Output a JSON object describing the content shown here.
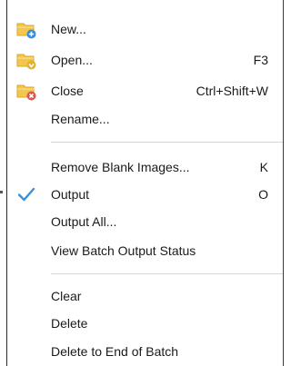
{
  "menu": {
    "items": [
      {
        "label": "New...",
        "shortcut": "",
        "icon": "folder-new-icon"
      },
      {
        "label": "Open...",
        "shortcut": "F3",
        "icon": "folder-open-icon"
      },
      {
        "label": "Close",
        "shortcut": "Ctrl+Shift+W",
        "icon": "folder-close-icon"
      },
      {
        "label": "Rename...",
        "shortcut": ""
      },
      {
        "label": "Remove Blank Images...",
        "shortcut": "K"
      },
      {
        "label": "Output",
        "shortcut": "O",
        "icon": "checkmark-icon",
        "checked": true
      },
      {
        "label": "Output All...",
        "shortcut": ""
      },
      {
        "label": "View Batch Output Status",
        "shortcut": ""
      },
      {
        "label": "Clear",
        "shortcut": ""
      },
      {
        "label": "Delete",
        "shortcut": ""
      },
      {
        "label": "Delete to End of Batch",
        "shortcut": ""
      }
    ]
  },
  "colors": {
    "folder": "#f3c74f",
    "folder_dark": "#d9a52b",
    "new_badge": "#2f8fd8",
    "open_badge": "#e3b22a",
    "close_badge": "#e0544f",
    "check": "#3d8fd6",
    "separator": "#d6d6d6"
  }
}
